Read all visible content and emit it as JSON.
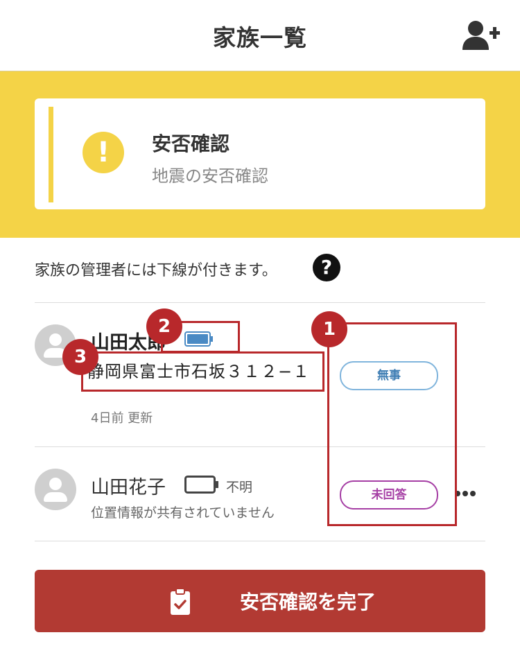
{
  "header": {
    "title": "家族一覧",
    "add_user_icon": "user-plus-icon"
  },
  "alert": {
    "title": "安否確認",
    "subtitle": "地震の安否確認",
    "icon": "exclamation-icon"
  },
  "note": {
    "text": "家族の管理者には下線が付きます。",
    "help_icon": "question-icon"
  },
  "members": [
    {
      "name": "山田太郎",
      "battery_icon": "battery-full-icon",
      "address": "静岡県富士市石坂３１２−１",
      "updated": "4日前 更新",
      "status": "無事",
      "status_color": "#3f7eb4"
    },
    {
      "name": "山田花子",
      "battery_icon": "battery-empty-icon",
      "battery_text": "不明",
      "location": "位置情報が共有されていません",
      "status": "未回答",
      "status_color": "#a53ea4",
      "more_icon": "more-horizontal-icon"
    }
  ],
  "complete_button": {
    "label": "安否確認を完了",
    "icon": "clipboard-check-icon"
  },
  "annotations": [
    "1",
    "2",
    "3"
  ],
  "colors": {
    "accent_yellow": "#f4d347",
    "button_red": "#b23a33",
    "annotation_red": "#b8282b"
  }
}
